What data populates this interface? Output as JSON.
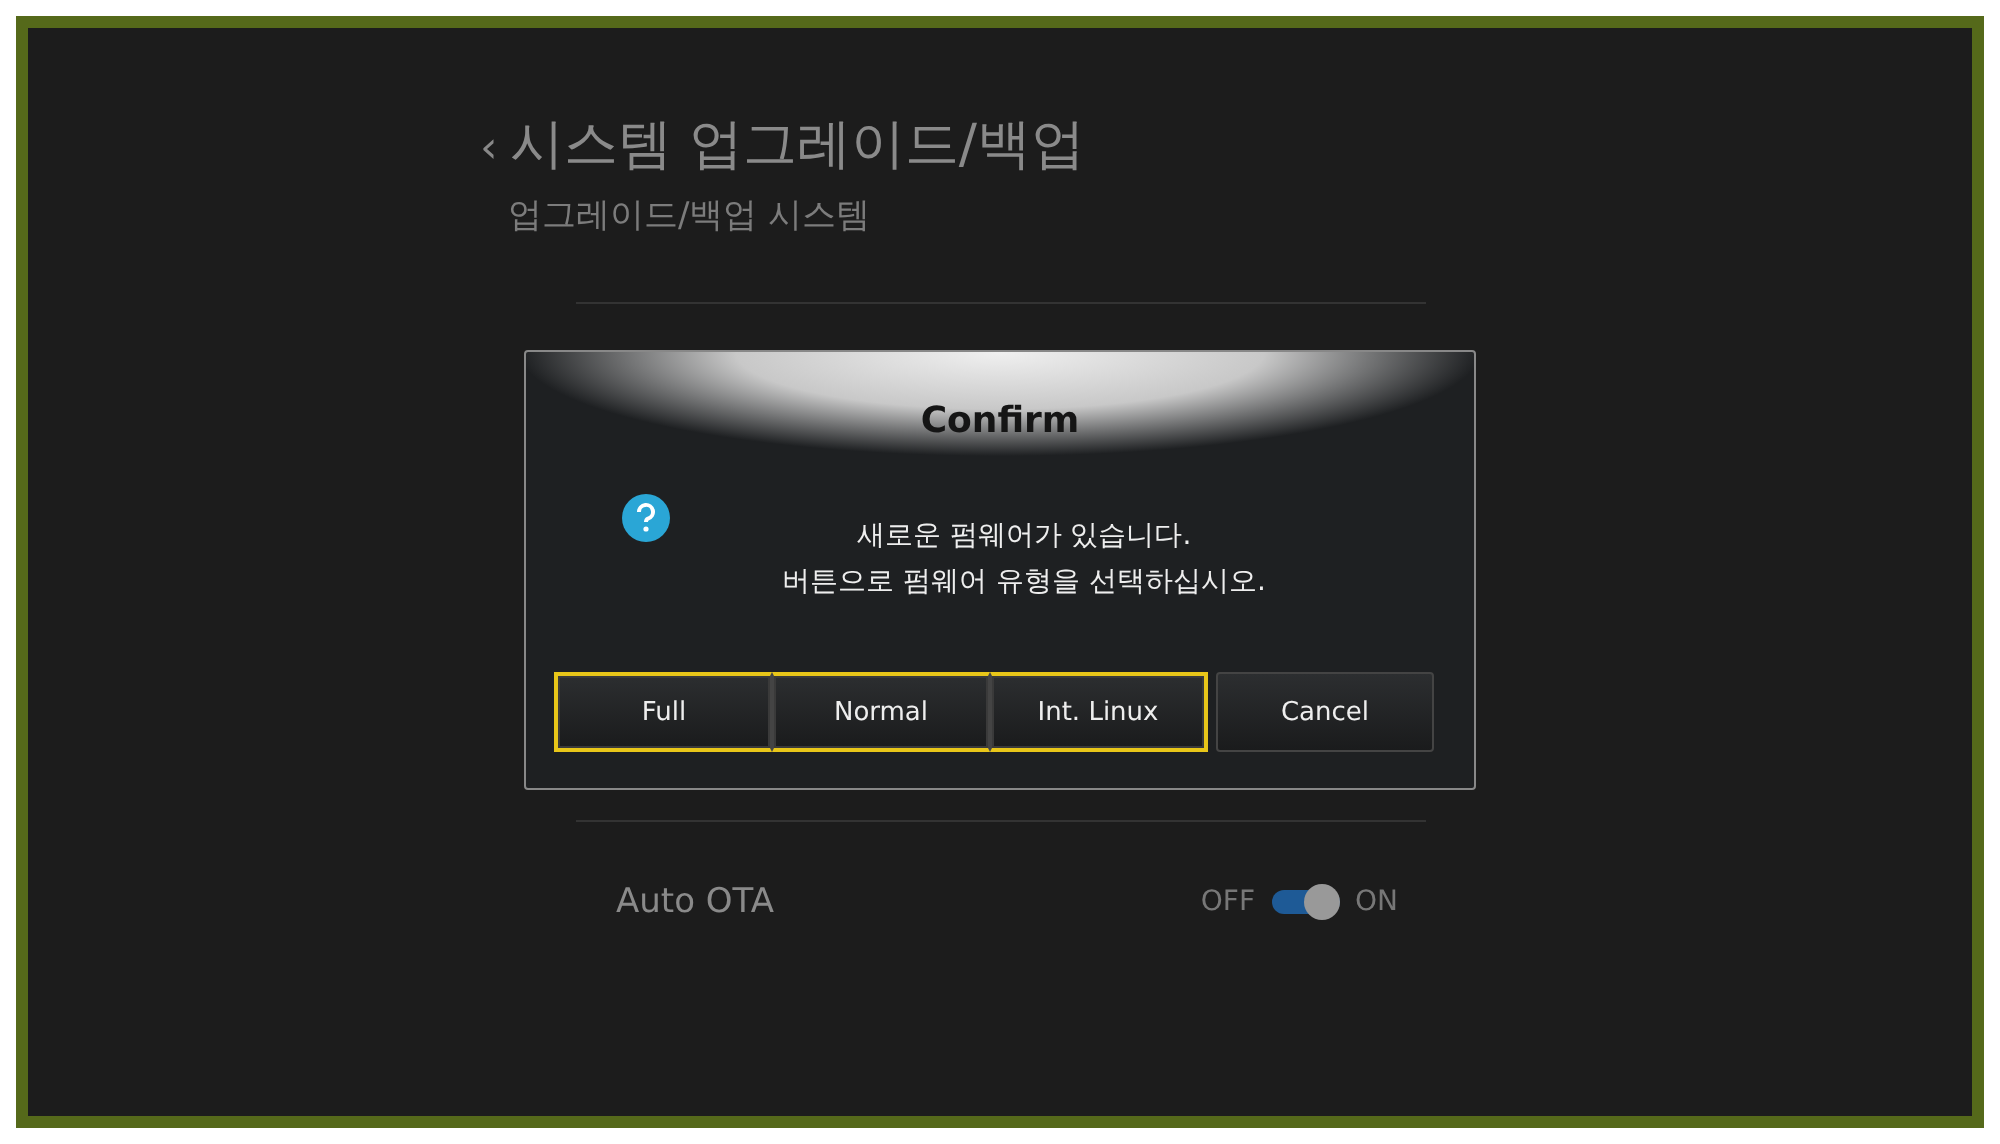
{
  "header": {
    "back": "‹",
    "title": "시스템 업그레이드/백업",
    "subtitle": "업그레이드/백업 시스템"
  },
  "settings": [
    {
      "label": "Auto OTA",
      "off_label": "OFF",
      "on_label": "ON",
      "on": true
    }
  ],
  "dialog": {
    "title": "Confirm",
    "message_lines": [
      "새로운 펌웨어가 있습니다.",
      "버튼으로 펌웨어 유형을 선택하십시오."
    ],
    "buttons": [
      {
        "label": "Full",
        "highlighted": true
      },
      {
        "label": "Normal",
        "highlighted": true
      },
      {
        "label": "Int. Linux",
        "highlighted": true
      },
      {
        "label": "Cancel",
        "highlighted": false
      }
    ]
  }
}
